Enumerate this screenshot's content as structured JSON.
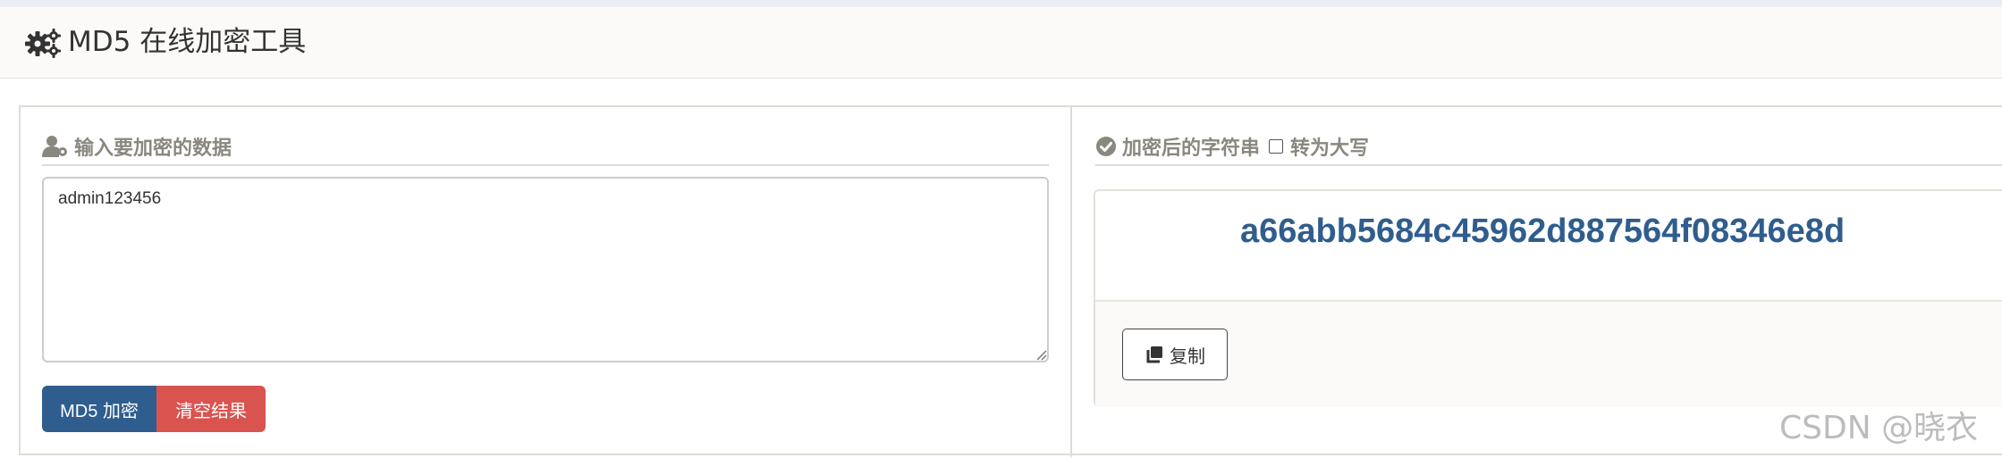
{
  "header": {
    "title": "MD5 在线加密工具",
    "icon": "gears-icon"
  },
  "input_section": {
    "title": "输入要加密的数据",
    "icon": "user-gear-icon",
    "value": "admin123456",
    "encrypt_label": "MD5 加密",
    "clear_label": "清空结果"
  },
  "output_section": {
    "title": "加密后的字符串",
    "icon": "check-circle-icon",
    "uppercase_label": "转为大写",
    "uppercase_checked": false,
    "hash": "a66abb5684c45962d887564f08346e8d",
    "copy_label": "复制",
    "copy_icon": "copy-icon"
  },
  "watermark": "CSDN @晓衣",
  "colors": {
    "primary": "#2f5d8e",
    "danger": "#d9534f",
    "section_title": "#8a877f"
  }
}
